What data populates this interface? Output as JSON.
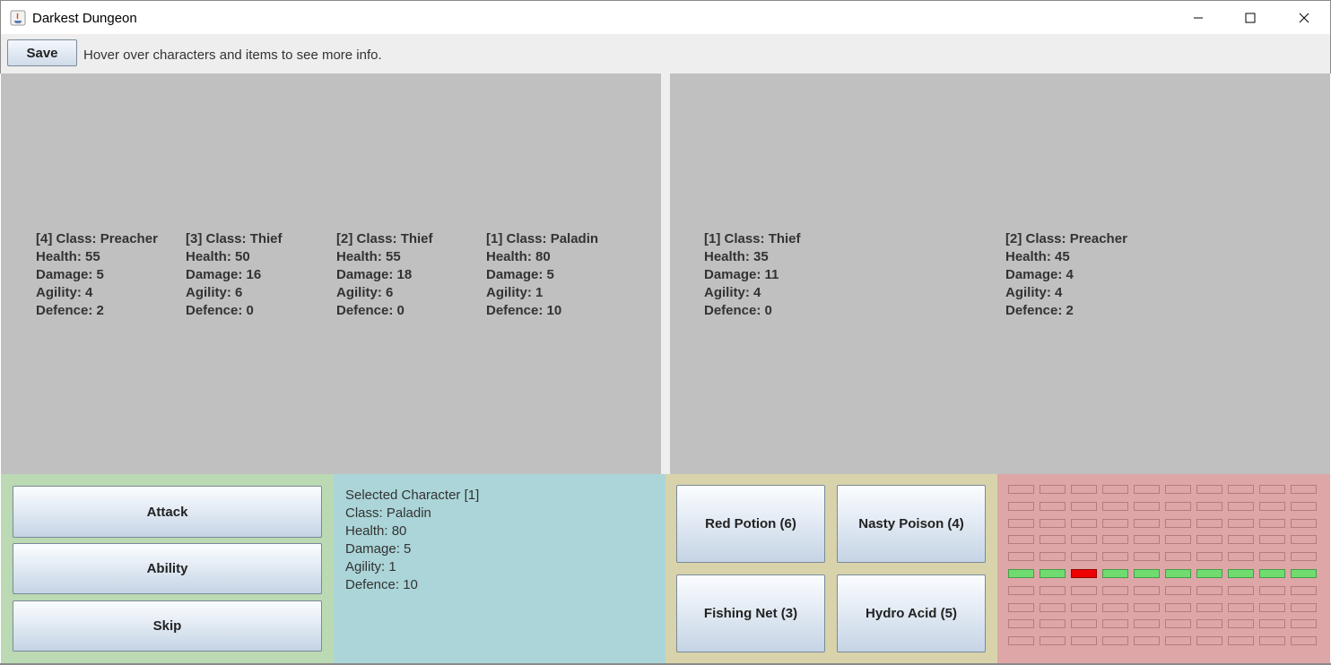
{
  "window": {
    "title": "Darkest Dungeon"
  },
  "toolbar": {
    "save_label": "Save",
    "hint": "Hover over characters and items to see more info."
  },
  "party": [
    {
      "header": "[4] Class: Preacher",
      "health": "Health: 55",
      "damage": "Damage: 5",
      "agility": "Agility: 4",
      "defence": "Defence: 2"
    },
    {
      "header": "[3] Class: Thief",
      "health": "Health: 50",
      "damage": "Damage: 16",
      "agility": "Agility: 6",
      "defence": "Defence: 0"
    },
    {
      "header": "[2] Class: Thief",
      "health": "Health: 55",
      "damage": "Damage: 18",
      "agility": "Agility: 6",
      "defence": "Defence: 0"
    },
    {
      "header": "[1] Class: Paladin",
      "health": "Health: 80",
      "damage": "Damage: 5",
      "agility": "Agility: 1",
      "defence": "Defence: 10"
    }
  ],
  "enemies": [
    {
      "header": "[1] Class: Thief",
      "health": "Health: 35",
      "damage": "Damage: 11",
      "agility": "Agility: 4",
      "defence": "Defence: 0"
    },
    {
      "header": "[2] Class: Preacher",
      "health": "Health: 45",
      "damage": "Damage: 4",
      "agility": "Agility: 4",
      "defence": "Defence: 2"
    }
  ],
  "actions": {
    "attack": "Attack",
    "ability": "Ability",
    "skip": "Skip"
  },
  "selected": {
    "title": "Selected Character [1]",
    "class": "Class: Paladin",
    "health": "Health: 80",
    "damage": "Damage: 5",
    "agility": "Agility: 1",
    "defence": "Defence: 10"
  },
  "items": {
    "red_potion": "Red Potion (6)",
    "nasty_poison": "Nasty Poison (4)",
    "fishing_net": "Fishing Net (3)",
    "hydro_acid": "Hydro Acid (5)"
  },
  "map_grid": {
    "rows": 10,
    "cols": 10,
    "green_row": 6,
    "red_cell": {
      "row": 6,
      "col": 3
    }
  },
  "colors": {
    "actions_panel": "#bbd9b2",
    "selected_panel": "#abd5d8",
    "items_panel": "#d8d3ab",
    "map_panel": "#dea6a6",
    "battle_bg": "#c0c0c0",
    "path_cell": "#70dc70",
    "current_cell": "#ee0000"
  }
}
